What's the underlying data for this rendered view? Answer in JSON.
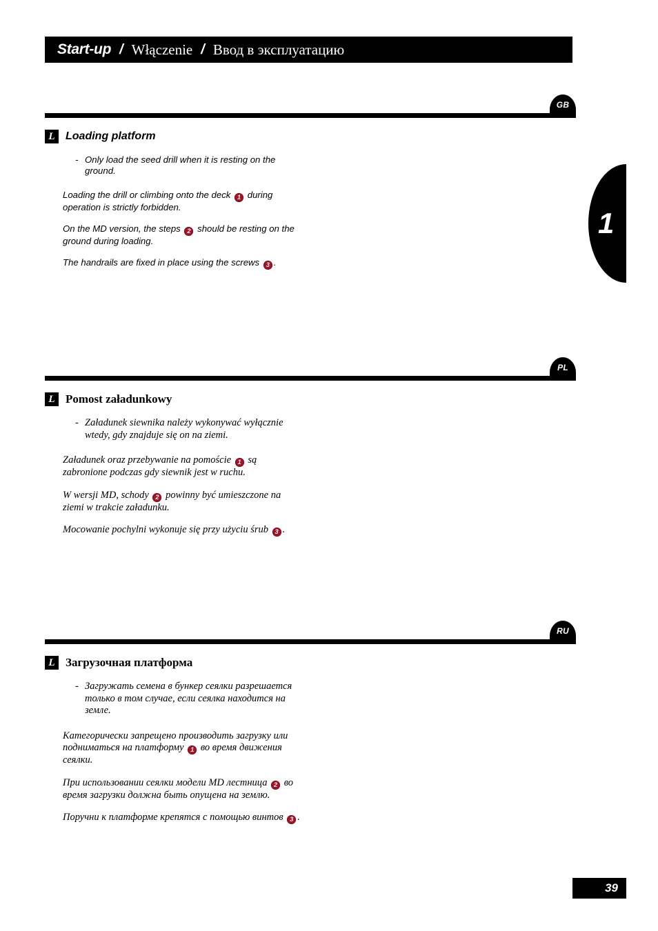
{
  "header": {
    "title_en": "Start-up",
    "separator": "/",
    "title_pl": "Włączenie",
    "title_ru": "Ввод в эксплуатацию"
  },
  "page_thumb": {
    "chapter_number": "1"
  },
  "page_footer": {
    "page_number": "39"
  },
  "sections": {
    "gb": {
      "badge": "GB",
      "marker": "L",
      "heading": "Loading platform",
      "dash_marker": "-",
      "dash_item": "Only load the seed drill when it is resting on the ground.",
      "para1_a": "Loading the drill or climbing onto the deck",
      "para1_ref": "1",
      "para1_b": "during operation is strictly forbidden.",
      "para2_a": "On the MD version, the steps",
      "para2_ref": "2",
      "para2_b": "should be resting on the ground during loading.",
      "para3_a": "The handrails are fixed in place using the screws",
      "para3_ref": "3",
      "para3_b": "."
    },
    "pl": {
      "badge": "PL",
      "marker": "L",
      "heading": "Pomost załadunkowy",
      "dash_marker": "-",
      "dash_item": "Załadunek siewnika należy wykonywać wyłącznie wtedy, gdy znajduje się on na ziemi.",
      "para1_a": "Załadunek oraz przebywanie na pomoście",
      "para1_ref": "1",
      "para1_b": "są zabronione podczas gdy siewnik jest w ruchu.",
      "para2_a": "W wersji MD, schody",
      "para2_ref": "2",
      "para2_b": "powinny być umieszczone na ziemi w trakcie załadunku.",
      "para3_a": "Mocowanie pochylni wykonuje się przy użyciu śrub",
      "para3_ref": "3",
      "para3_b": "."
    },
    "ru": {
      "badge": "RU",
      "marker": "L",
      "heading": "Загрузочная платформа",
      "dash_marker": "-",
      "dash_item": "Загружать семена в бункер сеялки разрешается только в том случае, если сеялка находится на земле.",
      "para1_a": "Категорически запрещено производить загрузку или подниматься на платформу",
      "para1_ref": "1",
      "para1_b": "во время движения сеялки.",
      "para2_a": "При использовании сеялки модели MD лестница",
      "para2_ref": "2",
      "para2_b": "во время загрузки должна быть опущена на землю.",
      "para3_a": "Поручни к платформе крепятся с помощью винтов",
      "para3_ref": "3",
      "para3_b": "."
    }
  },
  "colors": {
    "ink": "#000000",
    "paper": "#ffffff",
    "callout_red": "#a51326"
  }
}
